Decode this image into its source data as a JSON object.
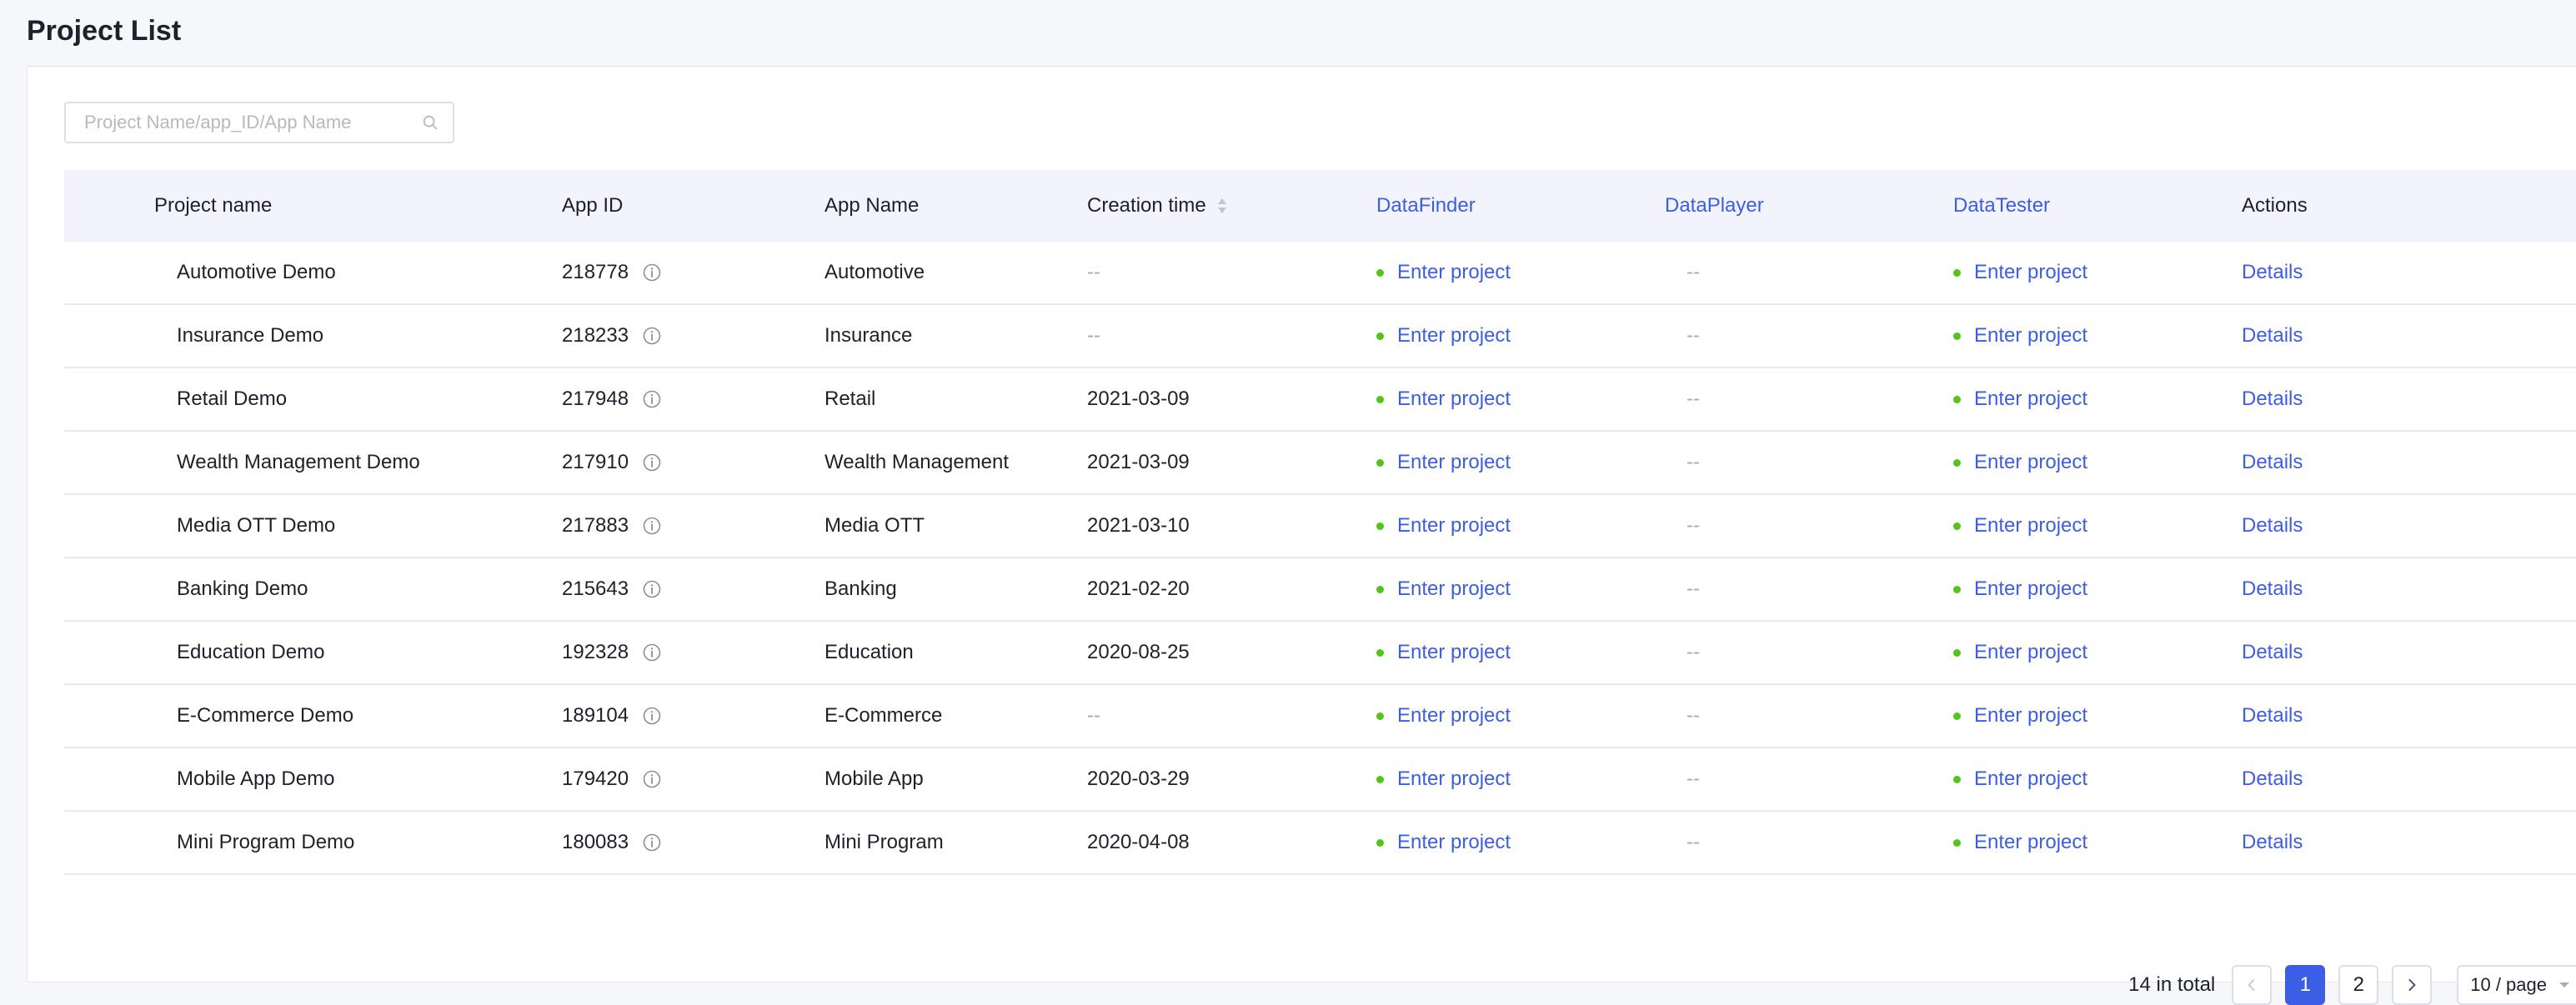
{
  "header": {
    "title": "Project List"
  },
  "search": {
    "placeholder": "Project Name/app_ID/App Name",
    "value": ""
  },
  "table": {
    "columns": {
      "project_name": "Project name",
      "app_id": "App ID",
      "app_name": "App Name",
      "creation_time": "Creation time",
      "datafinder": "DataFinder",
      "dataplayer": "DataPlayer",
      "datatester": "DataTester",
      "actions": "Actions"
    },
    "rows": [
      {
        "project_name": "Automotive Demo",
        "app_id": "218778",
        "app_name": "Automotive",
        "creation_time": "--",
        "datafinder": "Enter project",
        "dataplayer": "--",
        "datatester": "Enter project",
        "actions": "Details"
      },
      {
        "project_name": "Insurance Demo",
        "app_id": "218233",
        "app_name": "Insurance",
        "creation_time": "--",
        "datafinder": "Enter project",
        "dataplayer": "--",
        "datatester": "Enter project",
        "actions": "Details"
      },
      {
        "project_name": "Retail Demo",
        "app_id": "217948",
        "app_name": "Retail",
        "creation_time": "2021-03-09",
        "datafinder": "Enter project",
        "dataplayer": "--",
        "datatester": "Enter project",
        "actions": "Details"
      },
      {
        "project_name": "Wealth Management Demo",
        "app_id": "217910",
        "app_name": "Wealth Management",
        "creation_time": "2021-03-09",
        "datafinder": "Enter project",
        "dataplayer": "--",
        "datatester": "Enter project",
        "actions": "Details"
      },
      {
        "project_name": "Media OTT Demo",
        "app_id": "217883",
        "app_name": "Media OTT",
        "creation_time": "2021-03-10",
        "datafinder": "Enter project",
        "dataplayer": "--",
        "datatester": "Enter project",
        "actions": "Details"
      },
      {
        "project_name": "Banking Demo",
        "app_id": "215643",
        "app_name": "Banking",
        "creation_time": "2021-02-20",
        "datafinder": "Enter project",
        "dataplayer": "--",
        "datatester": "Enter project",
        "actions": "Details"
      },
      {
        "project_name": "Education Demo",
        "app_id": "192328",
        "app_name": "Education",
        "creation_time": "2020-08-25",
        "datafinder": "Enter project",
        "dataplayer": "--",
        "datatester": "Enter project",
        "actions": "Details"
      },
      {
        "project_name": "E-Commerce Demo",
        "app_id": "189104",
        "app_name": "E-Commerce",
        "creation_time": "--",
        "datafinder": "Enter project",
        "dataplayer": "--",
        "datatester": "Enter project",
        "actions": "Details"
      },
      {
        "project_name": "Mobile App Demo",
        "app_id": "179420",
        "app_name": "Mobile App",
        "creation_time": "2020-03-29",
        "datafinder": "Enter project",
        "dataplayer": "--",
        "datatester": "Enter project",
        "actions": "Details"
      },
      {
        "project_name": "Mini Program Demo",
        "app_id": "180083",
        "app_name": "Mini Program",
        "creation_time": "2020-04-08",
        "datafinder": "Enter project",
        "dataplayer": "--",
        "datatester": "Enter project",
        "actions": "Details"
      }
    ]
  },
  "pagination": {
    "total_text": "14 in total",
    "pages": [
      "1",
      "2"
    ],
    "current_page": "1",
    "page_size": "10 / page"
  },
  "icons": {
    "search": "search-icon",
    "info": "info-icon",
    "sort": "sort-icon",
    "status_dot": "status-dot",
    "prev": "chevron-left-icon",
    "next": "chevron-right-icon",
    "dropdown": "caret-down-icon"
  },
  "colors": {
    "link": "#3d5ee0",
    "status_dot": "#52c41a",
    "active_page": "#3c5de5",
    "header_bg": "#f2f3fb",
    "muted": "#a8acb5"
  }
}
